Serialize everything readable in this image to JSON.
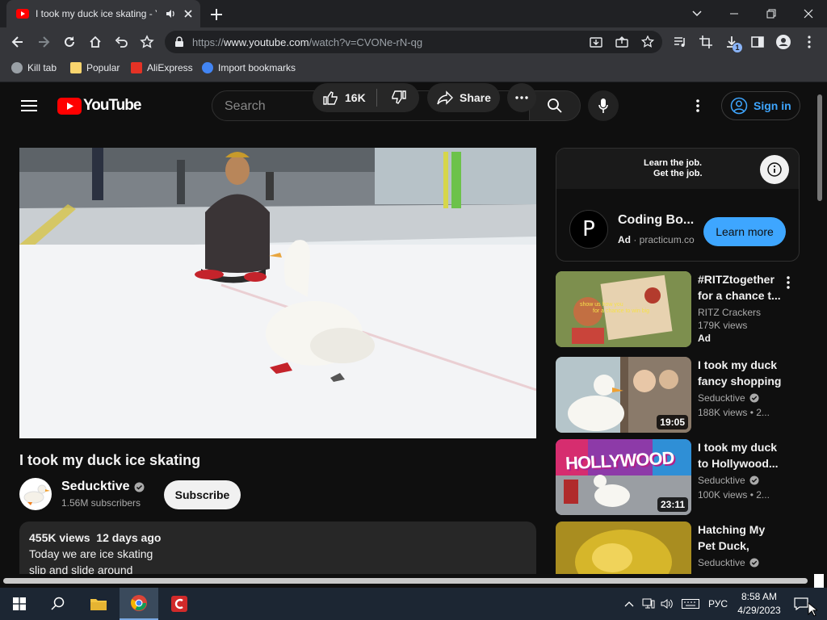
{
  "browser": {
    "tab_title": "I took my duck ice skating - YouTube",
    "url_prefix": "https://",
    "url_host": "www.youtube.com",
    "url_path": "/watch?v=CVONe-rN-qg",
    "bookmarks": [
      "Kill tab",
      "Popular",
      "AliExpress",
      "Import bookmarks"
    ],
    "download_badge": "1"
  },
  "youtube": {
    "logo_text": "YouTube",
    "search_placeholder": "Search",
    "signin_label": "Sign in",
    "video": {
      "title": "I took my duck ice skating",
      "channel": "Seducktive",
      "subscribers": "1.56M subscribers",
      "subscribe_label": "Subscribe",
      "likes": "16K",
      "share_label": "Share",
      "views": "455K views",
      "age": "12 days ago",
      "description_line1": "Today we are ice skating",
      "description_line2": "slip and slide around"
    },
    "ad": {
      "banner_line1": "Learn the job.",
      "banner_line2": "Get the job.",
      "logo_letter": "P",
      "name": "Coding Bo...",
      "ad_label": "Ad",
      "domain": "practicum.co",
      "cta": "Learn more"
    },
    "related": [
      {
        "title_1": "#RITZtogether",
        "title_2": "for a chance t...",
        "channel": "RITZ Crackers",
        "views": "179K views",
        "badge": "Ad",
        "duration": ""
      },
      {
        "title_1": "I took my duck",
        "title_2": "fancy shopping",
        "channel": "Seducktive",
        "views": "188K views",
        "age": "• 2...",
        "duration": "19:05"
      },
      {
        "title_1": "I took my duck",
        "title_2": "to Hollywood...",
        "channel": "Seducktive",
        "views": "100K views",
        "age": "• 2...",
        "duration": "23:11"
      },
      {
        "title_1": "Hatching My",
        "title_2": "Pet Duck,",
        "channel": "Seducktive",
        "views": "",
        "duration": ""
      }
    ],
    "thumb_text": {
      "hollywood": "HOLLYWOOD",
      "ritz_line1": "show us how you ",
      "ritz_line2": "for a chance to win big"
    }
  },
  "taskbar": {
    "language": "РУС",
    "time": "8:58 AM",
    "date": "4/29/2023"
  },
  "colors": {
    "yt_red": "#ff0000",
    "link_blue": "#3ea6ff",
    "cta_blue": "#3ea6ff",
    "chrome_dark": "#202124"
  }
}
